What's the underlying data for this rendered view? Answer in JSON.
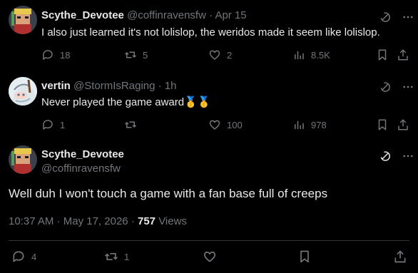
{
  "replies": [
    {
      "name": "Scythe_Devotee",
      "handle": "@coffinravensfw",
      "sep": "·",
      "time": "Apr 15",
      "text": "I also just learned it's not lolislop, the weridos made it seem like lolislop.",
      "replies": "18",
      "reposts": "5",
      "likes": "2",
      "views": "8.5K"
    },
    {
      "name": "vertin",
      "handle": "@StormIsRaging",
      "sep": "·",
      "time": "1h",
      "text": "Never played the game award",
      "emoji": "🥇🥇",
      "replies": "1",
      "reposts": "",
      "likes": "100",
      "views": "978"
    }
  ],
  "main": {
    "name": "Scythe_Devotee",
    "handle": "@coffinravensfw",
    "text": "Well duh I won't touch a game with a fan base full of creeps",
    "time": "10:37 AM",
    "date": "May 17, 2026",
    "sep": "·",
    "views_count": "757",
    "views_label": "Views",
    "replies": "4",
    "reposts": "1",
    "likes": ""
  },
  "icons": [
    "grok-icon",
    "more-icon",
    "reply-icon",
    "repost-icon",
    "like-icon",
    "views-icon",
    "bookmark-icon",
    "share-icon"
  ]
}
